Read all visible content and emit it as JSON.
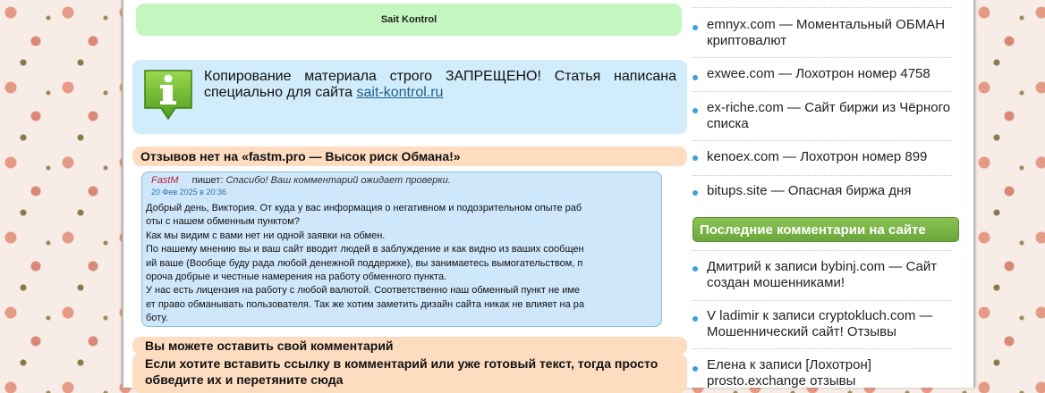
{
  "main": {
    "top_bar_title": "Sait Kontrol",
    "notice": {
      "text": "Копирование материала строго ЗАПРЕЩЕНО! Статья написана специально для сайта ",
      "link_text": "sait-kontrol.ru"
    },
    "no_reviews_heading": "Отзывов нет на «fastm.pro — Высок риск Обмана!»",
    "comment": {
      "author": "FastM",
      "says": "пишет:",
      "status": "Спасибо! Ваш комментарий ожидает проверки.",
      "date": "20 Фев 2025 в 20:36",
      "body": "Добрый день, Виктория. От куда у вас информация о негативном и подозрительном опыте раб\nоты с нашем обменным пунктом?\nКак мы видим с вами нет ни одной заявки на обмен.\nПо нашему мнению вы и ваш сайт вводит людей в заблуждение и как видно из ваших сообщен\nий ваше (Вообще буду рада любой денежной поддержке), вы занимаетесь вымогательством, п\nорочa добрые и честные намерения на работу обменного пункта.\nУ нас есть лицензия на работу с любой валютой. Соответственно наш обменный пункт не име\nет право обманывать пользователя. Так же хотим заметить дизайн сайта никак не влияет на ра\nботу."
    },
    "leave_comment_heading": "Вы можете оставить свой комментарий",
    "link_hint_heading": "Если хотите вставить ссылку в комментарий или уже готовый текст, тогда просто обведите их и перетяните сюда"
  },
  "sidebar": {
    "posts": [
      "emnyx.com — Моментальный ОБМАН криптовалют",
      "exwee.com — Лохотрон номер 4758",
      "ex-riche.com — Сайт биржи из Чёрного списка",
      "kenoex.com — Лохотрон номер 899",
      "bitups.site — Опасная биржа дня"
    ],
    "recent_comments_heading": "Последние комментарии на сайте",
    "comments": [
      "Дмитрий к записи bybinj.com — Сайт создан мошенниками!",
      "V ladimir к записи cryptokluch.com — Мошеннический сайт! Отзывы",
      "Елена к записи [Лохотрон] prosto.exchange отзывы"
    ]
  },
  "colors": {
    "green_bar": "#c4f6c0",
    "info_box": "#d1ecfb",
    "peach_heading": "#fddcc0",
    "sidebar_header": "#7ab548",
    "bullet": "#3a9fdb"
  },
  "icons": {
    "notice": "info-icon",
    "list_bullet": "bullet-dot-icon"
  }
}
